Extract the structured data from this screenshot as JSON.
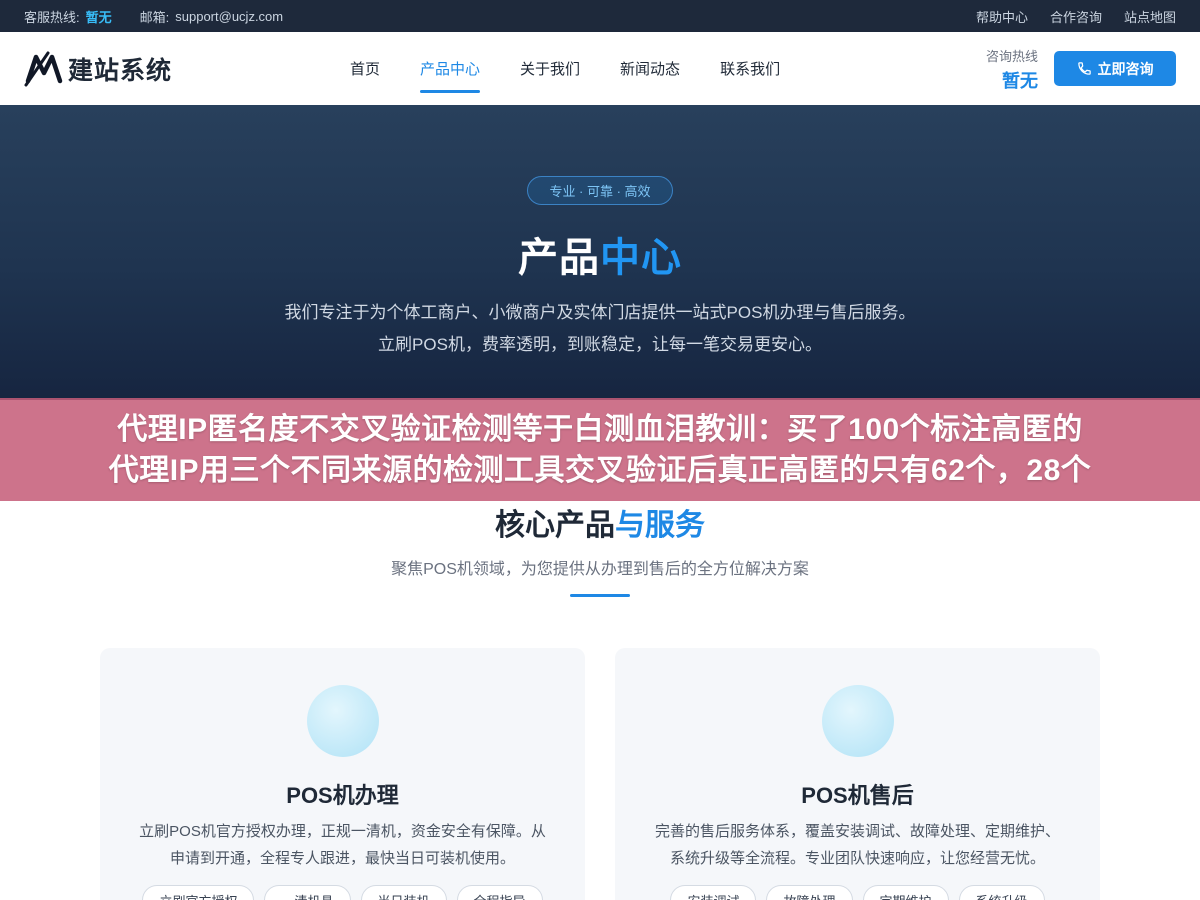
{
  "topbar": {
    "service_label": "客服热线:",
    "service_value": "暂无",
    "email_label": "邮箱:",
    "email_value": "support@ucjz.com",
    "links": [
      "帮助中心",
      "合作咨询",
      "站点地图"
    ]
  },
  "header": {
    "logo_text": "建站系统",
    "nav": [
      "首页",
      "产品中心",
      "关于我们",
      "新闻动态",
      "联系我们"
    ],
    "active_nav": "产品中心",
    "hotline_label": "咨询热线",
    "hotline_value": "暂无",
    "consult_button": "立即咨询"
  },
  "hero": {
    "tag": "专业 · 可靠 · 高效",
    "title_main": "产品",
    "title_accent": "中心",
    "desc_line1": "我们专注于为个体工商户、小微商户及实体门店提供一站式POS机办理与售后服务。",
    "desc_line2": "立刷POS机，费率透明，到账稳定，让每一笔交易更安心。"
  },
  "overlay": {
    "line1": "代理IP匿名度不交叉验证检测等于白测血泪教训：买了100个标注高匿的",
    "line2": "代理IP用三个不同来源的检测工具交叉验证后真正高匿的只有62个，28个"
  },
  "section": {
    "title_main": "核心产品",
    "title_accent": "与服务",
    "subtitle": "聚焦POS机领域，为您提供从办理到售后的全方位解决方案"
  },
  "cards": [
    {
      "title": "POS机办理",
      "desc_line1": "立刷POS机官方授权办理，正规一清机，资金安全有保障。从",
      "desc_line2": "申请到开通，全程专人跟进，最快当日可装机使用。",
      "tags": [
        "立刷官方授权",
        "一清机具",
        "当日装机",
        "全程指导"
      ]
    },
    {
      "title": "POS机售后",
      "desc_line1": "完善的售后服务体系，覆盖安装调试、故障处理、定期维护、",
      "desc_line2": "系统升级等全流程。专业团队快速响应，让您经营无忧。",
      "tags": [
        "安装调试",
        "故障处理",
        "定期维护",
        "系统升级"
      ]
    }
  ],
  "colors": {
    "accent": "#1e88e5",
    "topbar_bg": "#1e293b",
    "hero_bg": "#1f3450",
    "overlay_bg": "#c55c78"
  }
}
